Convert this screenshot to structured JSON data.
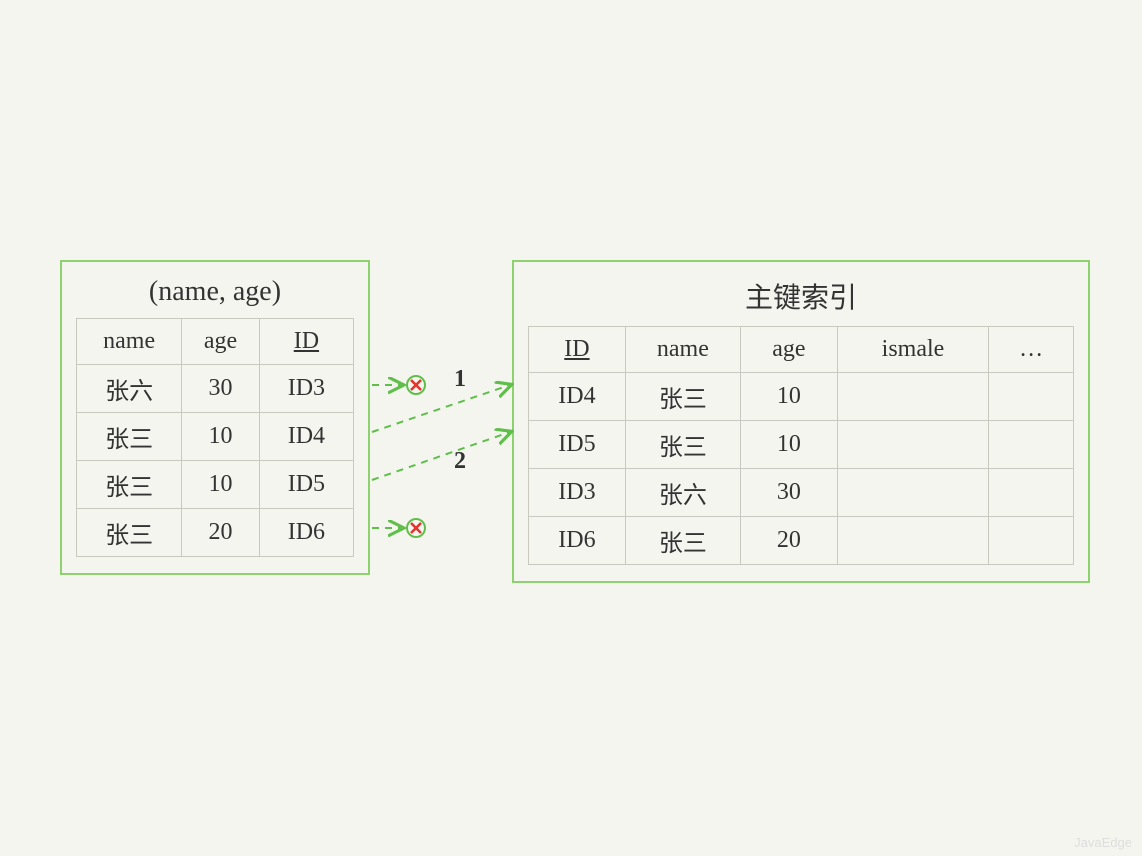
{
  "left": {
    "title": "(name, age)",
    "headers": {
      "c1": "name",
      "c2": "age",
      "c3": "ID"
    },
    "rows": [
      {
        "name": "张六",
        "age": "30",
        "id": "ID3"
      },
      {
        "name": "张三",
        "age": "10",
        "id": "ID4"
      },
      {
        "name": "张三",
        "age": "10",
        "id": "ID5"
      },
      {
        "name": "张三",
        "age": "20",
        "id": "ID6"
      }
    ]
  },
  "right": {
    "title": "主键索引",
    "headers": {
      "c1": "ID",
      "c2": "name",
      "c3": "age",
      "c4": "ismale",
      "c5": "…"
    },
    "rows": [
      {
        "id": "ID4",
        "name": "张三",
        "age": "10",
        "ismale": "",
        "more": ""
      },
      {
        "id": "ID5",
        "name": "张三",
        "age": "10",
        "ismale": "",
        "more": ""
      },
      {
        "id": "ID3",
        "name": "张六",
        "age": "30",
        "ismale": "",
        "more": ""
      },
      {
        "id": "ID6",
        "name": "张三",
        "age": "20",
        "ismale": "",
        "more": ""
      }
    ]
  },
  "arrows": {
    "label1": "1",
    "label2": "2"
  },
  "watermark": "JavaEdge"
}
